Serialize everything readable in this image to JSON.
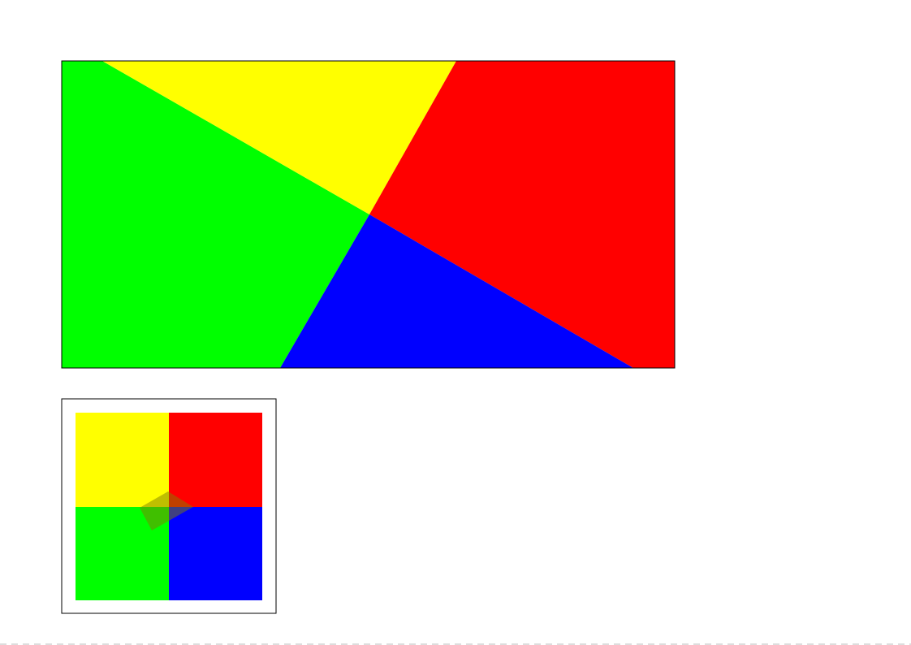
{
  "colors": {
    "yellow": "#ffff00",
    "red": "#ff0000",
    "green": "#00ff00",
    "blue": "#0000ff",
    "frame": "#000000",
    "page_border": "#bbbbbb",
    "selector_fill": "#808000",
    "selector_opacity": 0.5
  },
  "main_view": {
    "rotation_deg": -29
  },
  "overview": {
    "quadrants": [
      "yellow",
      "red",
      "green",
      "blue"
    ],
    "selector_rotation_deg": -29
  }
}
